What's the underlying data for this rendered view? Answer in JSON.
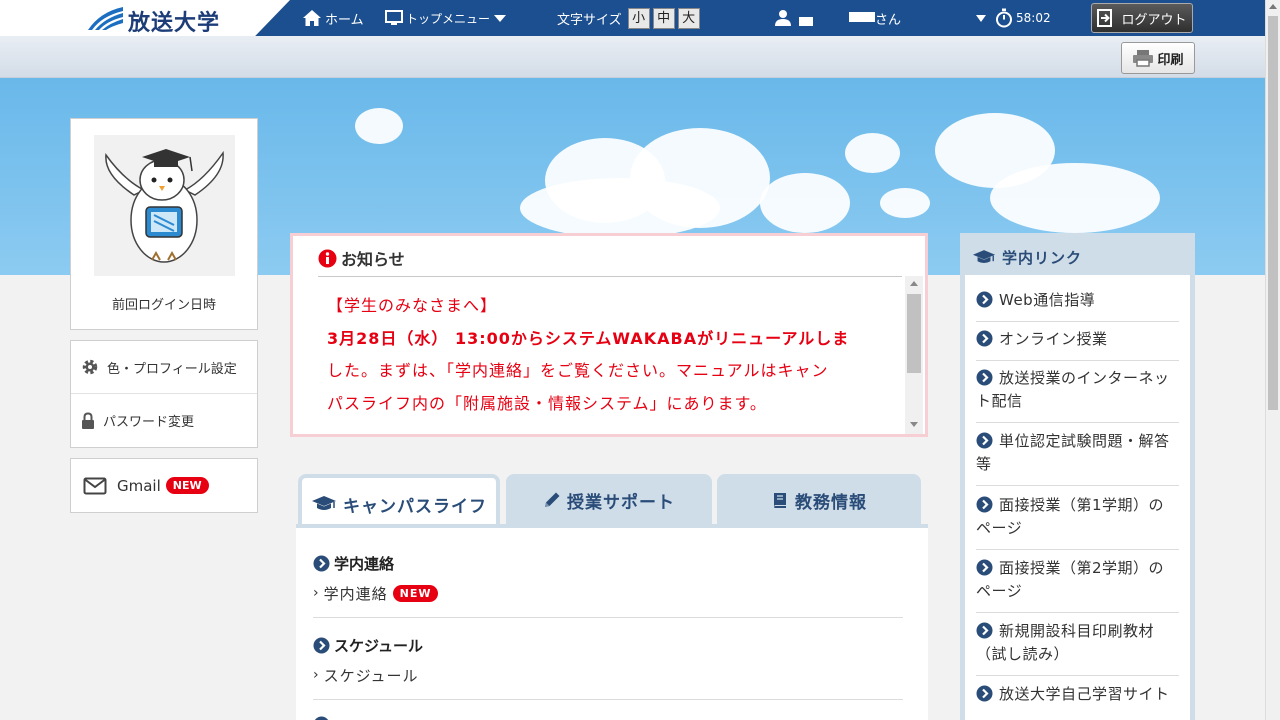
{
  "header": {
    "logo_text": "放送大学",
    "home_label": "ホーム",
    "top_menu_label": "トップメニュー",
    "font_size_label": "文字サイズ",
    "font_sizes": [
      "小",
      "中",
      "大"
    ],
    "user_suffix": "さん",
    "timer": "58:02",
    "logout_label": "ログアウト",
    "accent_color": "#1c4f8f"
  },
  "toolbar": {
    "print_label": "印刷"
  },
  "profile": {
    "last_login_label": "前回ログイン日時"
  },
  "settings": {
    "color_profile_label": "色・プロフィール設定",
    "password_label": "パスワード変更"
  },
  "gmail": {
    "label": "Gmail",
    "badge": "NEW"
  },
  "notice": {
    "title": "お知らせ",
    "line1": "【学生のみなさまへ】",
    "line2": "3月28日（水） 13:00からシステムWAKABAがリニューアルしま",
    "line3": "した。まずは、「学内連絡」をご覧ください。マニュアルはキャン",
    "line4": "パスライフ内の「附属施設・情報システム」にあります。",
    "text_color": "#e60012"
  },
  "tabs": [
    {
      "label": "キャンパスライフ",
      "icon": "graduation-cap-icon"
    },
    {
      "label": "授業サポート",
      "icon": "pencil-icon"
    },
    {
      "label": "教務情報",
      "icon": "book-icon"
    }
  ],
  "sections": [
    {
      "title": "学内連絡",
      "link": "学内連絡",
      "badge": "NEW"
    },
    {
      "title": "スケジュール",
      "link": "スケジュール"
    }
  ],
  "links": {
    "title": "学内リンク",
    "items": [
      "Web通信指導",
      "オンライン授業",
      "放送授業のインターネット配信",
      "単位認定試験問題・解答等",
      "面接授業（第1学期）のページ",
      "面接授業（第2学期）のページ",
      "新規開設科目印刷教材（試し読み）",
      "放送大学自己学習サイト"
    ]
  }
}
